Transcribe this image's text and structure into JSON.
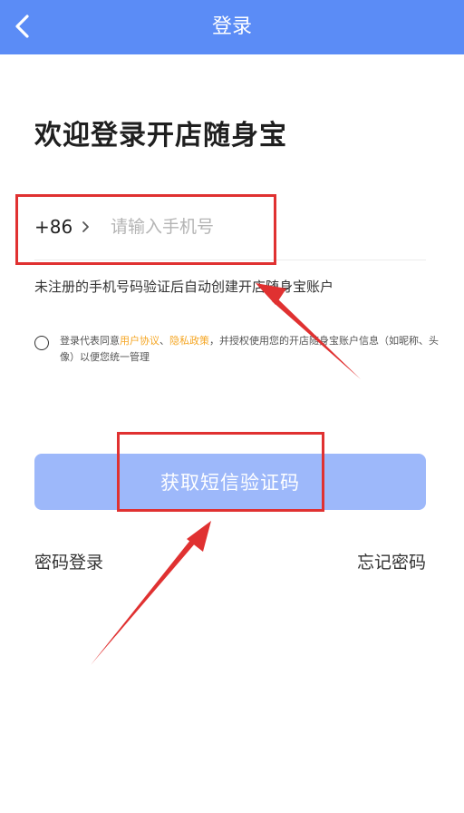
{
  "header": {
    "title": "登录"
  },
  "welcome_title": "欢迎登录开店随身宝",
  "phone": {
    "country_code": "+86",
    "placeholder": "请输入手机号",
    "value": ""
  },
  "register_hint": "未注册的手机号码验证后自动创建开店随身宝账户",
  "agreement": {
    "prefix": "登录代表同意",
    "user_agreement": "用户协议",
    "separator": "、",
    "privacy_policy": "隐私政策",
    "suffix": "，并授权使用您的开店随身宝账户信息（如昵称、头像）以便您统一管理",
    "checked": false
  },
  "sms_button_label": "获取短信验证码",
  "password_login_label": "密码登录",
  "forgot_password_label": "忘记密码",
  "colors": {
    "header": "#5b8cf6",
    "button": "#9db8fa",
    "link": "#f5a623",
    "annotation": "#e03131"
  }
}
